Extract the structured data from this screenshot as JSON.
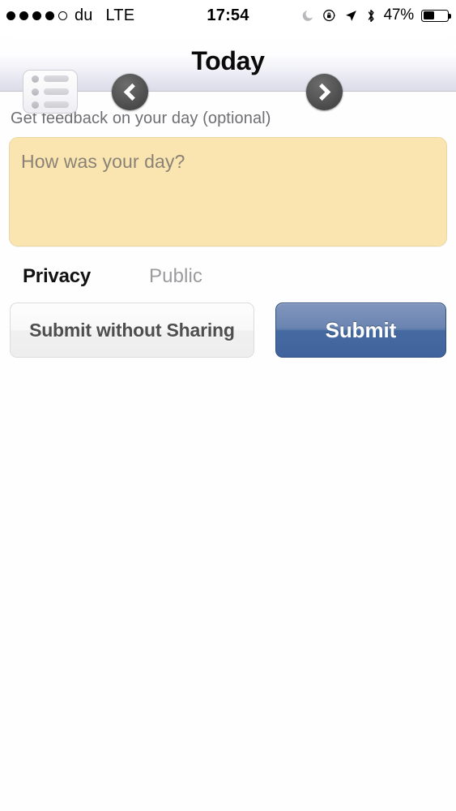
{
  "status_bar": {
    "signal_dots_filled": 4,
    "signal_dots_total": 5,
    "carrier": "du",
    "network": "LTE",
    "time": "17:54",
    "battery_percent": "47%",
    "battery_level": 47,
    "icons": [
      "moon-icon",
      "rotation-lock-icon",
      "location-arrow-icon",
      "bluetooth-icon"
    ]
  },
  "nav_bar": {
    "title": "Today",
    "list_button_name": "list-menu-button",
    "prev_button_name": "previous-day-button",
    "next_button_name": "next-day-button"
  },
  "form": {
    "feedback_label": "Get feedback on your day (optional)",
    "feedback_placeholder": "How was your day?",
    "feedback_value": "",
    "privacy_label": "Privacy",
    "privacy_value": "Public"
  },
  "actions": {
    "submit_without_sharing_label": "Submit without Sharing",
    "submit_label": "Submit"
  },
  "colors": {
    "textarea_bg": "#fae5b0",
    "primary_button": "#41639d",
    "nav_bar_bottom": "#dcdce9",
    "muted_text": "#6e6e73"
  }
}
